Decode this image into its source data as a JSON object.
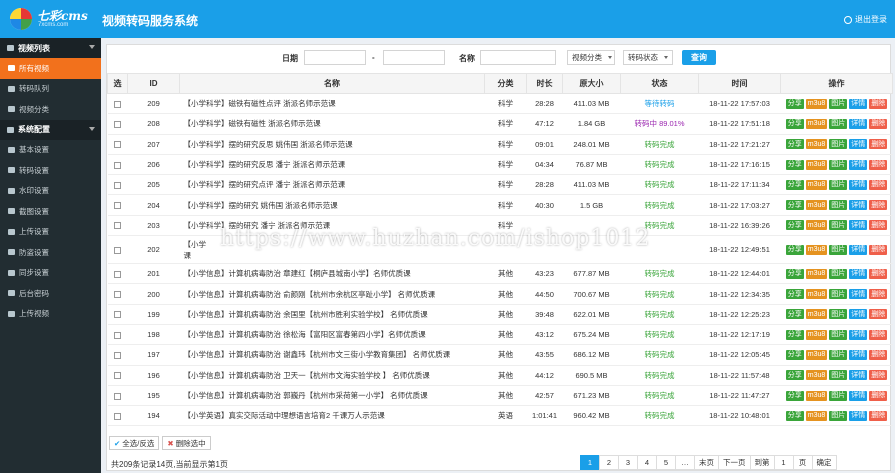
{
  "header": {
    "logo_text": "七彩cms",
    "logo_sub": "7xcms.com",
    "title": "视频转码服务系统",
    "logout": "退出登录",
    "bg_color": "#1a9fe8"
  },
  "sidebar": {
    "groups": [
      {
        "label": "视频列表",
        "items": [
          "所有视频",
          "转码队列",
          "视频分类"
        ]
      },
      {
        "label": "系统配置",
        "items": [
          "基本设置",
          "转码设置",
          "水印设置",
          "截图设置",
          "上传设置",
          "防盗设置",
          "同步设置",
          "后台密码",
          "上传视频"
        ]
      }
    ],
    "active_item": "所有视频",
    "active_color": "#f2711c"
  },
  "filter": {
    "date_label": "日期",
    "date_sep": "-",
    "name_label": "名称",
    "category_select": "视频分类",
    "status_select": "转码状态",
    "query_button": "查询"
  },
  "table": {
    "headers": [
      "选",
      "ID",
      "名称",
      "分类",
      "时长",
      "原大小",
      "状态",
      "时间",
      "操作"
    ],
    "ops": [
      "分享",
      "m3u8",
      "图片",
      "详情",
      "删除"
    ],
    "rows": [
      {
        "id": "209",
        "name": "【小学科学】磁铁有磁性点评 浙派名师示范课",
        "cat": "科学",
        "dur": "28:28",
        "size": "411.03 MB",
        "status": "等待转码",
        "st": "wait",
        "time": "18-11-22 17:57:03"
      },
      {
        "id": "208",
        "name": "【小学科学】磁铁有磁性 浙派名师示范课",
        "cat": "科学",
        "dur": "47:12",
        "size": "1.84 GB",
        "status": "转码中 89.01%",
        "st": "doing",
        "time": "18-11-22 17:51:18"
      },
      {
        "id": "207",
        "name": "【小学科学】摆的研究反思 姚伟国 浙派名师示范课",
        "cat": "科学",
        "dur": "09:01",
        "size": "248.01 MB",
        "status": "转码完成",
        "st": "done",
        "time": "18-11-22 17:21:27"
      },
      {
        "id": "206",
        "name": "【小学科学】摆的研究反思 潘宁 浙派名师示范课",
        "cat": "科学",
        "dur": "04:34",
        "size": "76.87 MB",
        "status": "转码完成",
        "st": "done",
        "time": "18-11-22 17:16:15"
      },
      {
        "id": "205",
        "name": "【小学科学】摆的研究点评 潘宁 浙派名师示范课",
        "cat": "科学",
        "dur": "28:28",
        "size": "411.03 MB",
        "status": "转码完成",
        "st": "done",
        "time": "18-11-22 17:11:34"
      },
      {
        "id": "204",
        "name": "【小学科学】摆的研究 姚伟国 浙派名师示范课",
        "cat": "科学",
        "dur": "40:30",
        "size": "1.5 GB",
        "status": "转码完成",
        "st": "done",
        "time": "18-11-22 17:03:27"
      },
      {
        "id": "203",
        "name": "【小学科学】摆的研究 潘宁 浙派名师示范课",
        "cat": "科学",
        "dur": "",
        "size": "",
        "status": "转码完成",
        "st": "done",
        "time": "18-11-22 16:39:26"
      },
      {
        "id": "202",
        "name": "【小学",
        "name2": "课",
        "cat": "",
        "dur": "",
        "size": "",
        "status": "",
        "st": "done",
        "time": "18-11-22 12:49:51"
      },
      {
        "id": "201",
        "name": "【小学信息】计算机病毒防治 章建红【桐庐县城南小学】名师优质课",
        "cat": "其他",
        "dur": "43:23",
        "size": "677.87 MB",
        "status": "转码完成",
        "st": "done",
        "time": "18-11-22 12:44:01"
      },
      {
        "id": "200",
        "name": "【小学信息】计算机病毒防治 俞颜刚【杭州市余杭区亭趾小学】 名师优质课",
        "cat": "其他",
        "dur": "44:50",
        "size": "700.67 MB",
        "status": "转码完成",
        "st": "done",
        "time": "18-11-22 12:34:35"
      },
      {
        "id": "199",
        "name": "【小学信息】计算机病毒防治 余国里【杭州市胜利实验学校】 名师优质课",
        "cat": "其他",
        "dur": "39:48",
        "size": "622.01 MB",
        "status": "转码完成",
        "st": "done",
        "time": "18-11-22 12:25:23"
      },
      {
        "id": "198",
        "name": "【小学信息】计算机病毒防治 徐松海【富阳区富春第四小学】名师优质课",
        "cat": "其他",
        "dur": "43:12",
        "size": "675.24 MB",
        "status": "转码完成",
        "st": "done",
        "time": "18-11-22 12:17:19"
      },
      {
        "id": "197",
        "name": "【小学信息】计算机病毒防治 谢鑫玮【杭州市文三街小学教育集团】 名师优质课",
        "cat": "其他",
        "dur": "43:55",
        "size": "686.12 MB",
        "status": "转码完成",
        "st": "done",
        "time": "18-11-22 12:05:45"
      },
      {
        "id": "196",
        "name": "【小学信息】计算机病毒防治 卫天一【杭州市文海实验学校 】 名师优质课",
        "cat": "其他",
        "dur": "44:12",
        "size": "690.5 MB",
        "status": "转码完成",
        "st": "done",
        "time": "18-11-22 11:57:48"
      },
      {
        "id": "195",
        "name": "【小学信息】计算机病毒防治 郭巍丹【杭州市采荷第一小学】 名师优质课",
        "cat": "其他",
        "dur": "42:57",
        "size": "671.23 MB",
        "status": "转码完成",
        "st": "done",
        "time": "18-11-22 11:47:27"
      },
      {
        "id": "194",
        "name": "【小学英语】真实交际活动中理想语言培育2 千课万人示范课",
        "cat": "英语",
        "dur": "1:01:41",
        "size": "960.42 MB",
        "status": "转码完成",
        "st": "done",
        "time": "18-11-22 10:48:01"
      }
    ]
  },
  "footer": {
    "select_all": "全选/反选",
    "delete_selected": "删除选中",
    "summary": "共209条记录14页,当前显示第1页",
    "pages": [
      "1",
      "2",
      "3",
      "4",
      "5",
      "…",
      "末页",
      "下一页",
      "到第",
      "页",
      "确定"
    ],
    "current_page": "1",
    "goto_value": "1"
  },
  "watermark": "https://www.huzhan.com/ishop1012"
}
